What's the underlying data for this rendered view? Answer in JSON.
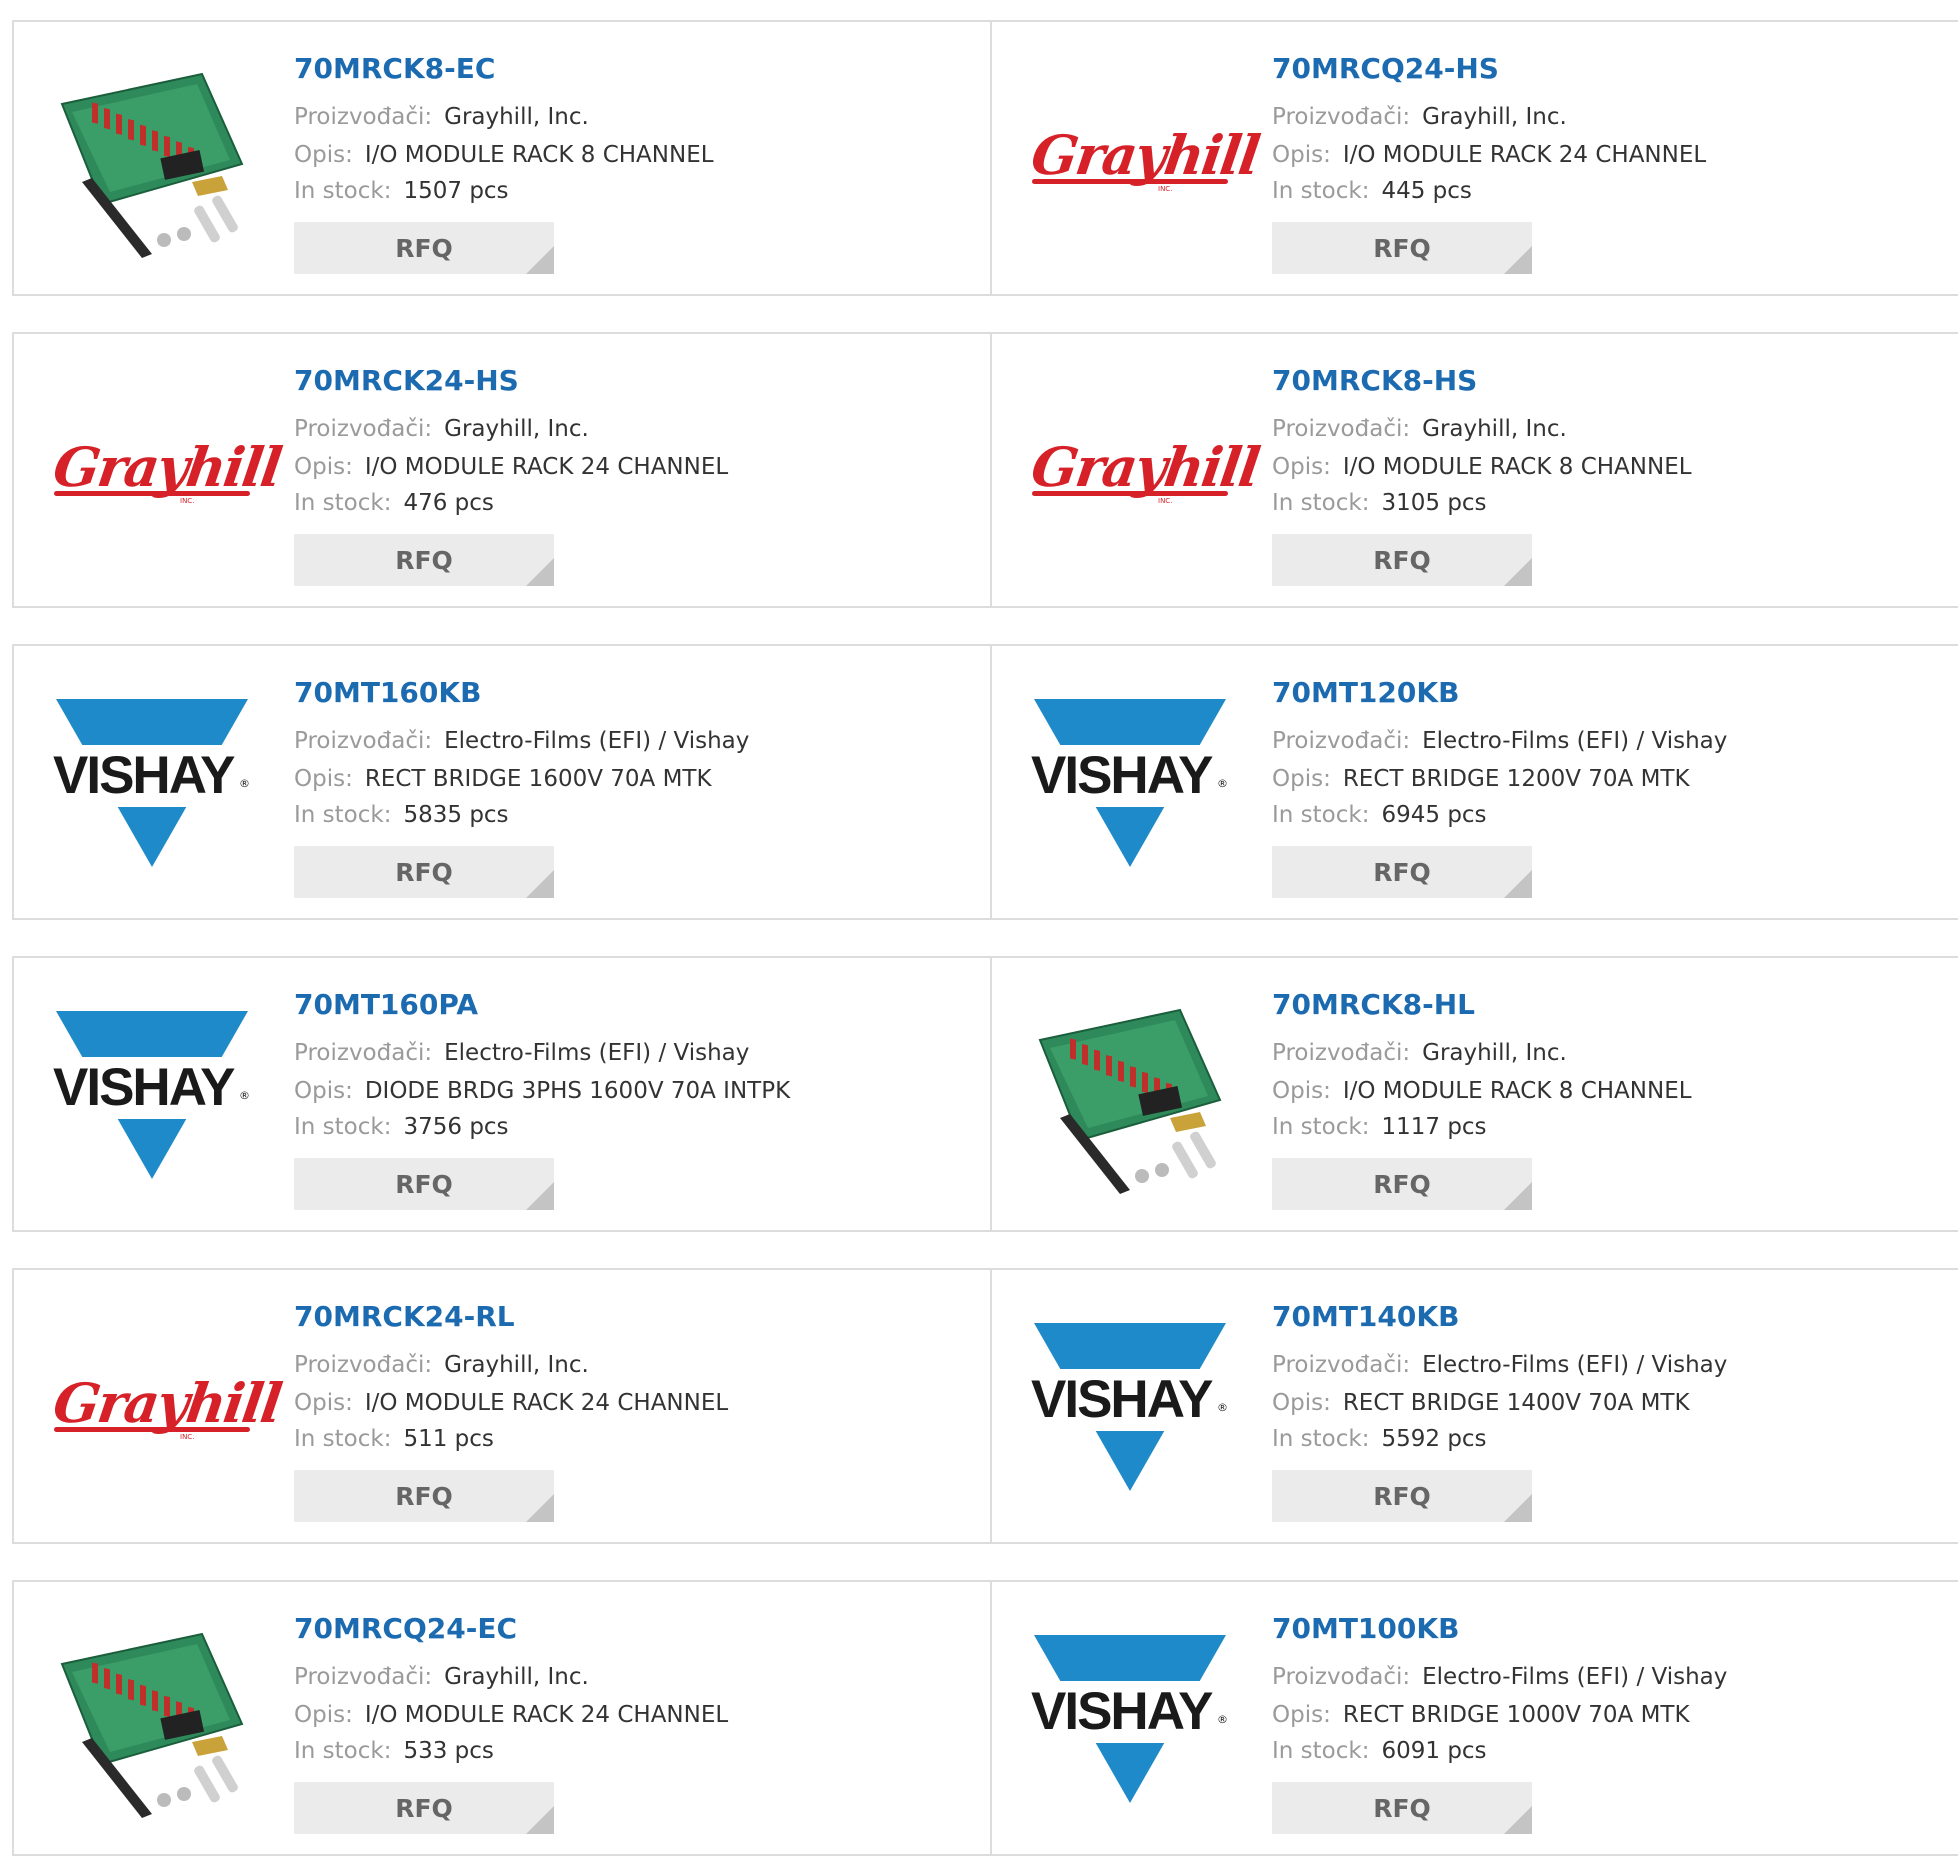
{
  "labels": {
    "manufacturer": "Proizvođači:",
    "description": "Opis:",
    "stock": "In stock:",
    "rfq": "RFQ"
  },
  "colors": {
    "part_link": "#1c6bb0",
    "grayhill_red": "#d62128",
    "vishay_blue": "#1f8ac9",
    "rfq_bg": "#ebebeb"
  },
  "products": [
    {
      "part": "70MRCK8-EC",
      "manufacturer": "Grayhill, Inc.",
      "description": "I/O MODULE RACK 8 CHANNEL",
      "stock": "1507 pcs",
      "image": "board-photo"
    },
    {
      "part": "70MRCQ24-HS",
      "manufacturer": "Grayhill, Inc.",
      "description": "I/O MODULE RACK 24 CHANNEL",
      "stock": "445 pcs",
      "image": "grayhill-logo"
    },
    {
      "part": "70MRCK24-HS",
      "manufacturer": "Grayhill, Inc.",
      "description": "I/O MODULE RACK 24 CHANNEL",
      "stock": "476 pcs",
      "image": "grayhill-logo"
    },
    {
      "part": "70MRCK8-HS",
      "manufacturer": "Grayhill, Inc.",
      "description": "I/O MODULE RACK 8 CHANNEL",
      "stock": "3105 pcs",
      "image": "grayhill-logo"
    },
    {
      "part": "70MT160KB",
      "manufacturer": "Electro-Films (EFI) / Vishay",
      "description": "RECT BRIDGE 1600V 70A MTK",
      "stock": "5835 pcs",
      "image": "vishay-logo"
    },
    {
      "part": "70MT120KB",
      "manufacturer": "Electro-Films (EFI) / Vishay",
      "description": "RECT BRIDGE 1200V 70A MTK",
      "stock": "6945 pcs",
      "image": "vishay-logo"
    },
    {
      "part": "70MT160PA",
      "manufacturer": "Electro-Films (EFI) / Vishay",
      "description": "DIODE BRDG 3PHS 1600V 70A INTPK",
      "stock": "3756 pcs",
      "image": "vishay-logo"
    },
    {
      "part": "70MRCK8-HL",
      "manufacturer": "Grayhill, Inc.",
      "description": "I/O MODULE RACK 8 CHANNEL",
      "stock": "1117 pcs",
      "image": "board-photo"
    },
    {
      "part": "70MRCK24-RL",
      "manufacturer": "Grayhill, Inc.",
      "description": "I/O MODULE RACK 24 CHANNEL",
      "stock": "511 pcs",
      "image": "grayhill-logo"
    },
    {
      "part": "70MT140KB",
      "manufacturer": "Electro-Films (EFI) / Vishay",
      "description": "RECT BRIDGE 1400V 70A MTK",
      "stock": "5592 pcs",
      "image": "vishay-logo"
    },
    {
      "part": "70MRCQ24-EC",
      "manufacturer": "Grayhill, Inc.",
      "description": "I/O MODULE RACK 24 CHANNEL",
      "stock": "533 pcs",
      "image": "board-photo"
    },
    {
      "part": "70MT100KB",
      "manufacturer": "Electro-Films (EFI) / Vishay",
      "description": "RECT BRIDGE 1000V 70A MTK",
      "stock": "6091 pcs",
      "image": "vishay-logo"
    }
  ],
  "logos": {
    "grayhill_text": "Grayhill",
    "grayhill_inc": "INC.",
    "vishay_text": "VISHAY",
    "vishay_reg": "®"
  }
}
